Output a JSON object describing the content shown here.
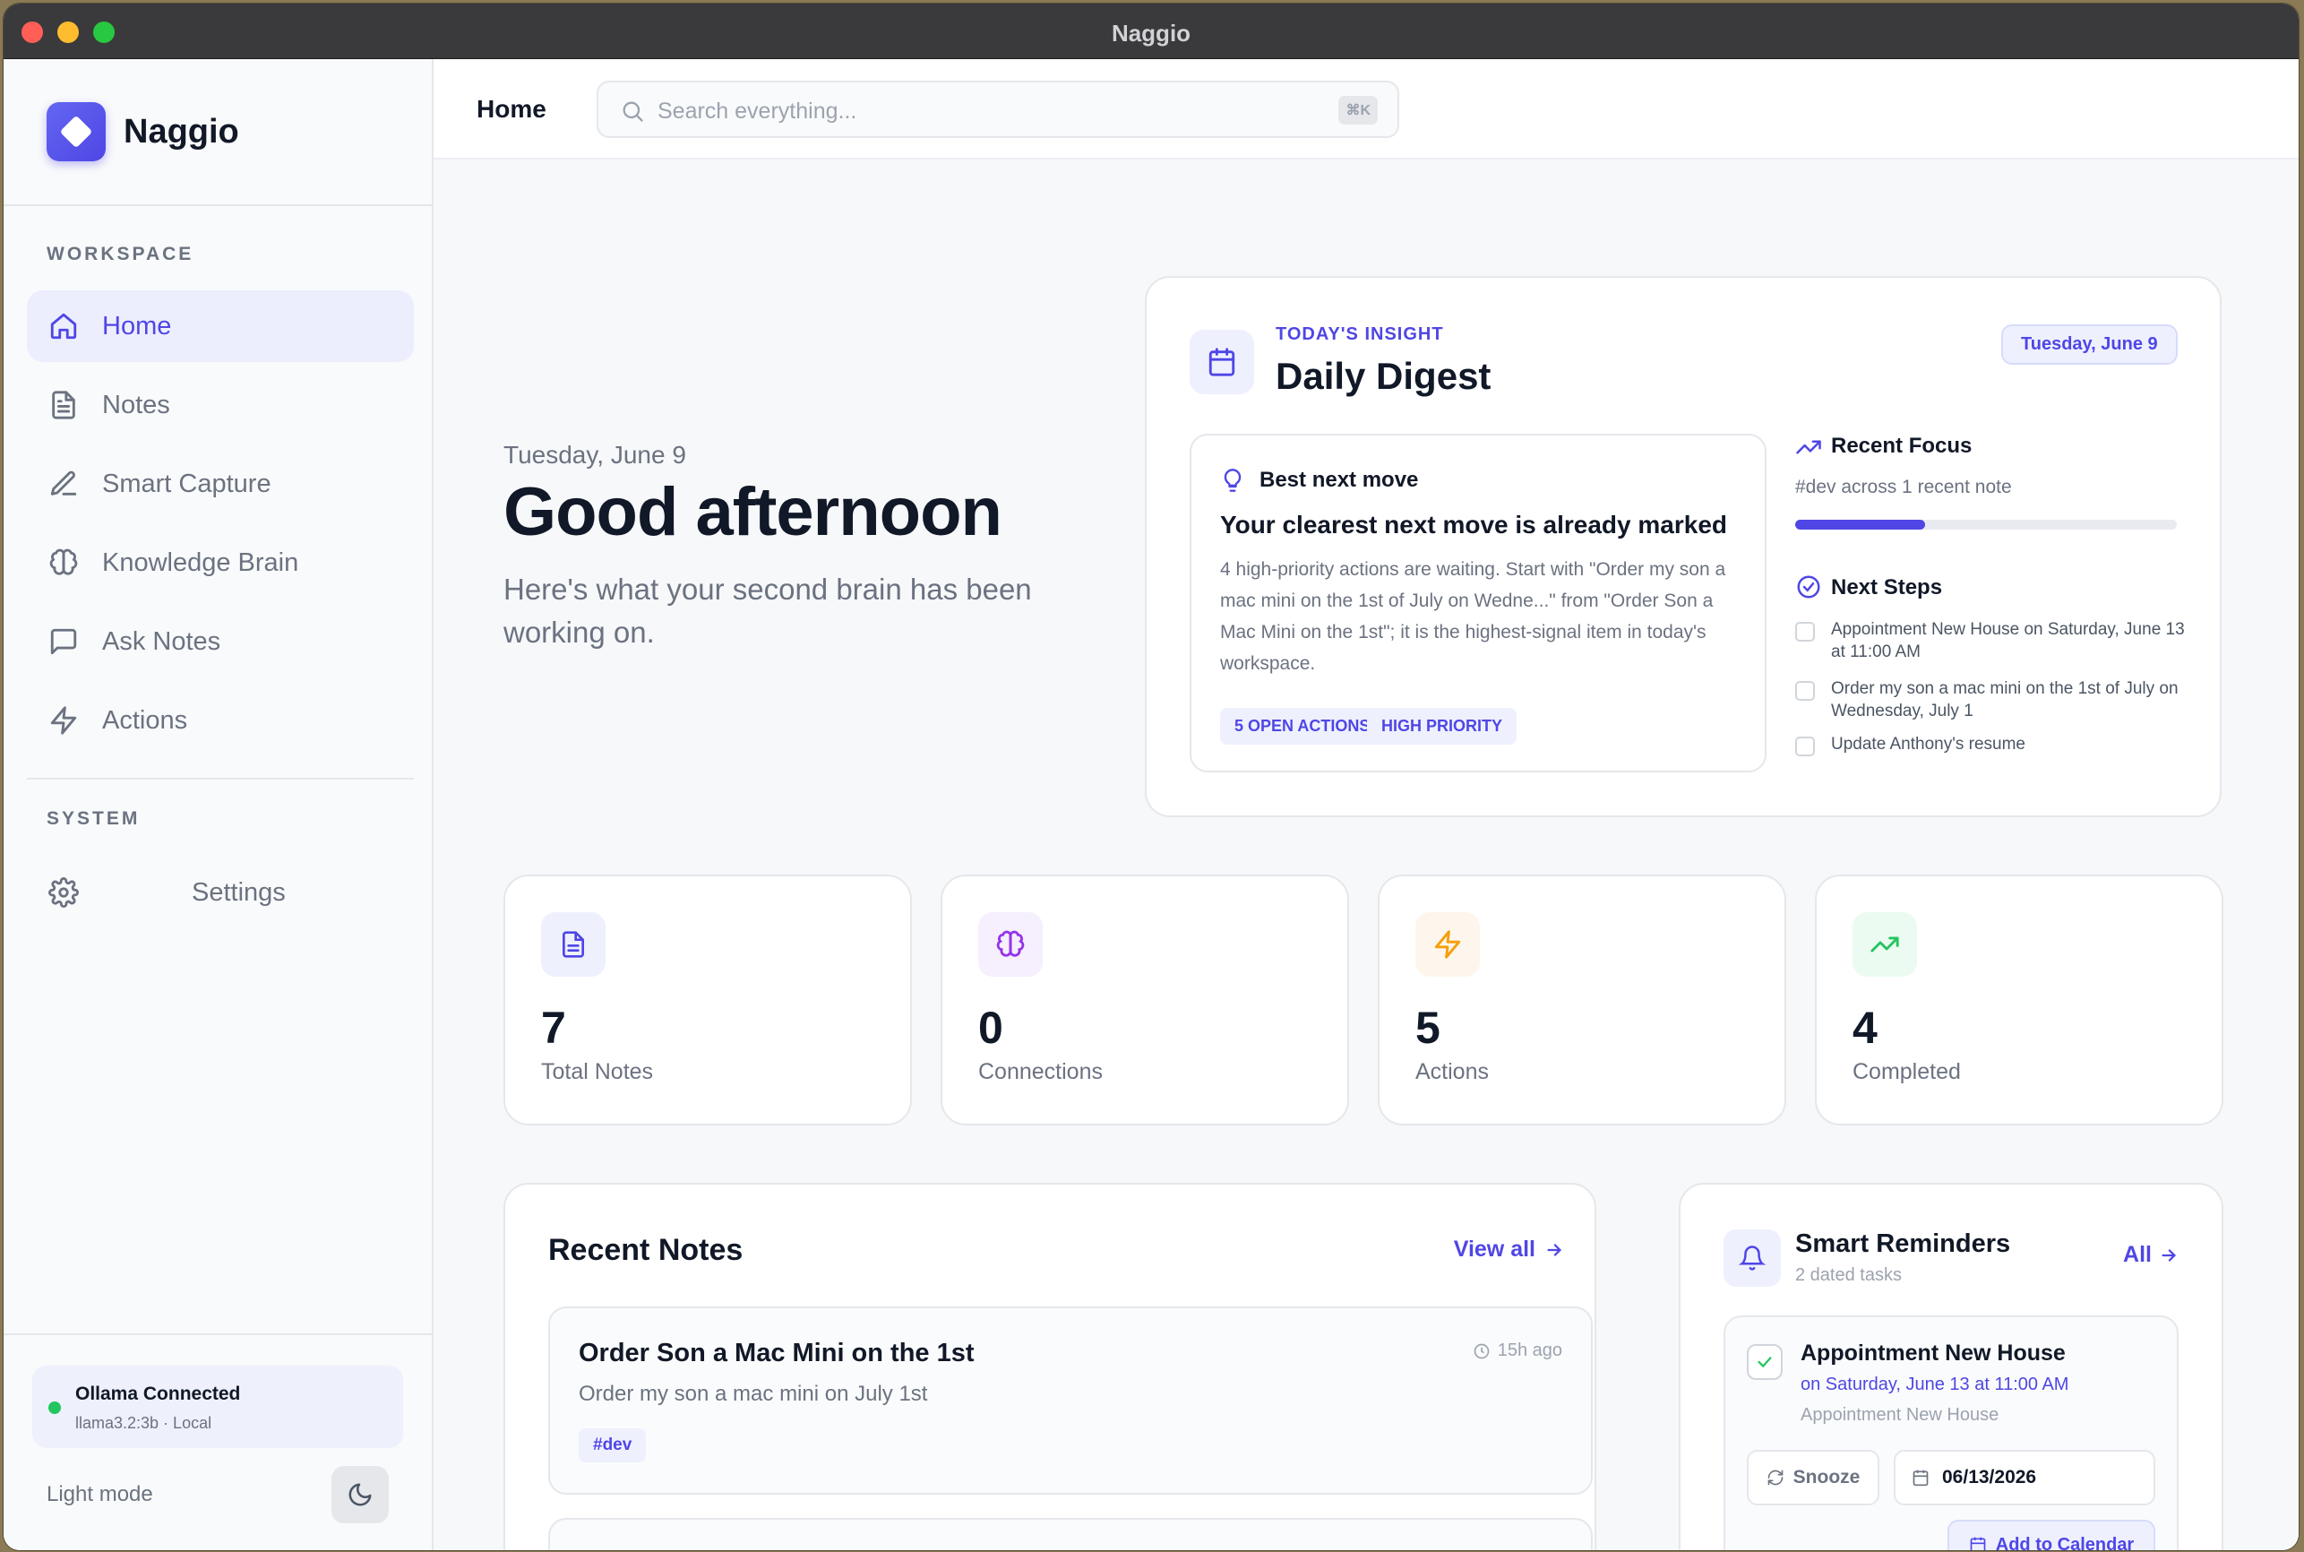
{
  "window": {
    "title": "Naggio"
  },
  "sidebar": {
    "brand": "Naggio",
    "workspace_label": "WORKSPACE",
    "items": [
      {
        "label": "Home",
        "icon": "home-icon",
        "active": true
      },
      {
        "label": "Notes",
        "icon": "file-text-icon"
      },
      {
        "label": "Smart Capture",
        "icon": "pen-icon"
      },
      {
        "label": "Knowledge Brain",
        "icon": "brain-icon"
      },
      {
        "label": "Ask Notes",
        "icon": "message-square-icon"
      },
      {
        "label": "Actions",
        "icon": "zap-icon"
      }
    ],
    "system_label": "SYSTEM",
    "settings_label": "Settings",
    "status": {
      "title": "Ollama Connected",
      "detail": "llama3.2:3b · Local"
    },
    "mode_label": "Light mode"
  },
  "topbar": {
    "title": "Home",
    "search_placeholder": "Search everything...",
    "shortcut": "⌘K"
  },
  "greeting": {
    "date": "Tuesday, June 9",
    "title": "Good afternoon",
    "subtitle": "Here's what your second brain has been working on."
  },
  "digest": {
    "kicker": "TODAY'S INSIGHT",
    "title": "Daily Digest",
    "date_pill": "Tuesday, June 9",
    "best_move": {
      "label": "Best next move",
      "headline": "Your clearest next move is already marked",
      "body": "4 high-priority actions are waiting. Start with \"Order my son a mac mini on the 1st of July on Wedne...\" from \"Order Son a Mac Mini on the 1st\"; it is the highest-signal item in today's workspace.",
      "tags": [
        "5 OPEN ACTIONS",
        "HIGH PRIORITY"
      ]
    },
    "recent_focus": {
      "label": "Recent Focus",
      "text": "#dev across 1 recent note",
      "progress": 0.34
    },
    "next_steps": {
      "label": "Next Steps",
      "items": [
        "Appointment New House on Saturday, June 13 at 11:00 AM",
        "Order my son a mac mini on the 1st of July on Wednesday, July 1",
        "Update Anthony's resume"
      ]
    }
  },
  "stats": [
    {
      "value": "7",
      "label": "Total Notes",
      "icon": "file-text-icon",
      "color": "#4f46e5",
      "bg": "#eef0fe"
    },
    {
      "value": "0",
      "label": "Connections",
      "icon": "brain-icon",
      "color": "#9333ea",
      "bg": "#f5effe"
    },
    {
      "value": "5",
      "label": "Actions",
      "icon": "zap-icon",
      "color": "#f59e0b",
      "bg": "#fef6ec"
    },
    {
      "value": "4",
      "label": "Completed",
      "icon": "trending-up-icon",
      "color": "#22c55e",
      "bg": "#ecfbf1"
    }
  ],
  "recent_notes": {
    "title": "Recent Notes",
    "view_all": "View all",
    "notes": [
      {
        "title": "Order Son a Mac Mini on the 1st",
        "time": "15h ago",
        "body": "Order my son a mac mini on July 1st",
        "tag": "#dev"
      }
    ]
  },
  "reminders": {
    "title": "Smart Reminders",
    "subtitle": "2 dated tasks",
    "all_link": "All",
    "items": [
      {
        "title": "Appointment New House",
        "when": "on Saturday, June 13 at 11:00 AM",
        "note": "Appointment New House",
        "snooze": "Snooze",
        "date": "06/13/2026",
        "calendar": "Add to Calendar"
      }
    ]
  }
}
